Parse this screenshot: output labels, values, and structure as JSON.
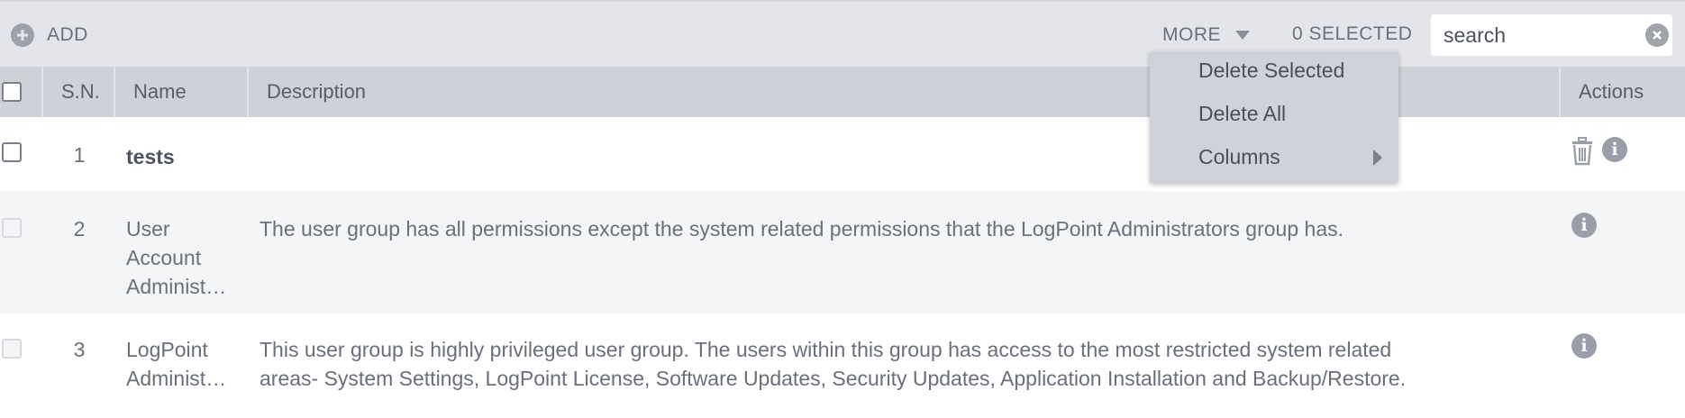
{
  "toolbar": {
    "add_label": "ADD",
    "more_label": "MORE",
    "selected_label": "0 SELECTED",
    "search_placeholder": "search"
  },
  "table": {
    "headers": {
      "sn": "S.N.",
      "name": "Name",
      "description": "Description",
      "actions": "Actions"
    },
    "rows": [
      {
        "sn": "1",
        "name": "tests",
        "description": "",
        "actions": [
          "trash-icon",
          "info-icon"
        ]
      },
      {
        "sn": "2",
        "name_lines": [
          "User",
          "Account",
          "Administ…"
        ],
        "description": "The user group has all permissions except the system related permissions that the LogPoint Administrators group has.",
        "actions": [
          "info-icon"
        ]
      },
      {
        "sn": "3",
        "name_lines": [
          "LogPoint",
          "Administ…"
        ],
        "description_lines": [
          "This user group is highly privileged user group. The users within this group has access to the most restricted system related",
          "areas- System Settings, LogPoint License, Software Updates, Security Updates, Application Installation and Backup/Restore."
        ],
        "actions": [
          "info-icon"
        ]
      }
    ]
  },
  "menu": {
    "items": [
      "Delete Selected",
      "Delete All",
      "Columns"
    ]
  },
  "colors": {
    "toolbar_bg": "#e3e5ea",
    "header_bg": "#cfd1d8",
    "row_alt_bg": "#f4f5f7",
    "icon_gray": "#9a9ea8"
  }
}
